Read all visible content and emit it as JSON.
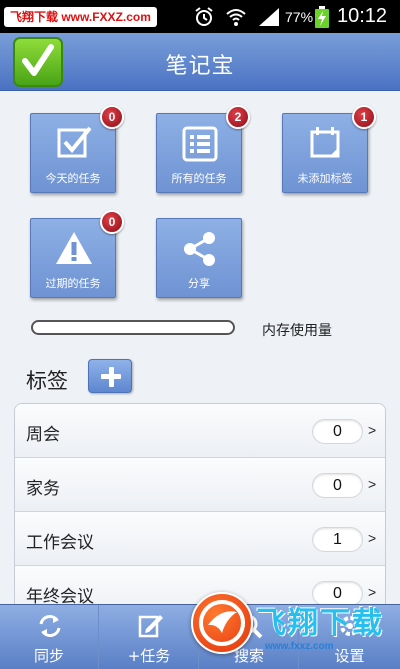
{
  "status_bar": {
    "watermark": "飞翔下载 www.FXXZ.com",
    "battery_percent": "77%",
    "time": "10:12",
    "icons": [
      "alarm-icon",
      "wifi-icon",
      "signal-icon",
      "battery-charging-icon"
    ]
  },
  "header": {
    "title": "笔记宝",
    "logo_icon": "checkmark-icon"
  },
  "tiles": [
    {
      "label": "今天的任务",
      "badge": "0",
      "icon": "checkbox-icon"
    },
    {
      "label": "所有的任务",
      "badge": "2",
      "icon": "list-icon"
    },
    {
      "label": "未添加标签",
      "badge": "1",
      "icon": "tag-icon"
    },
    {
      "label": "过期的任务",
      "badge": "0",
      "icon": "warning-icon"
    },
    {
      "label": "分享",
      "icon": "share-icon"
    }
  ],
  "memory": {
    "label": "内存使用量",
    "usage_fraction": 0.0
  },
  "tags": {
    "title": "标签",
    "add_icon": "plus-icon",
    "items": [
      {
        "name": "周会",
        "count": "0"
      },
      {
        "name": "家务",
        "count": "0"
      },
      {
        "name": "工作会议",
        "count": "1"
      },
      {
        "name": "年终会议",
        "count": "0"
      }
    ],
    "arrow": ">"
  },
  "bottom_nav": [
    {
      "label": "同步",
      "icon": "sync-icon"
    },
    {
      "label": "+任务",
      "icon": "edit-icon"
    },
    {
      "label": "搜索",
      "icon": "search-icon"
    },
    {
      "label": "设置",
      "icon": "gear-icon"
    }
  ],
  "watermark_overlay": {
    "text": "飞翔下载",
    "url": "www.fxxz.com"
  },
  "colors": {
    "accent": "#6f93d3",
    "badge": "#a3121c",
    "logo_green": "#6cc127",
    "watermark_blue": "#27c0ee"
  }
}
